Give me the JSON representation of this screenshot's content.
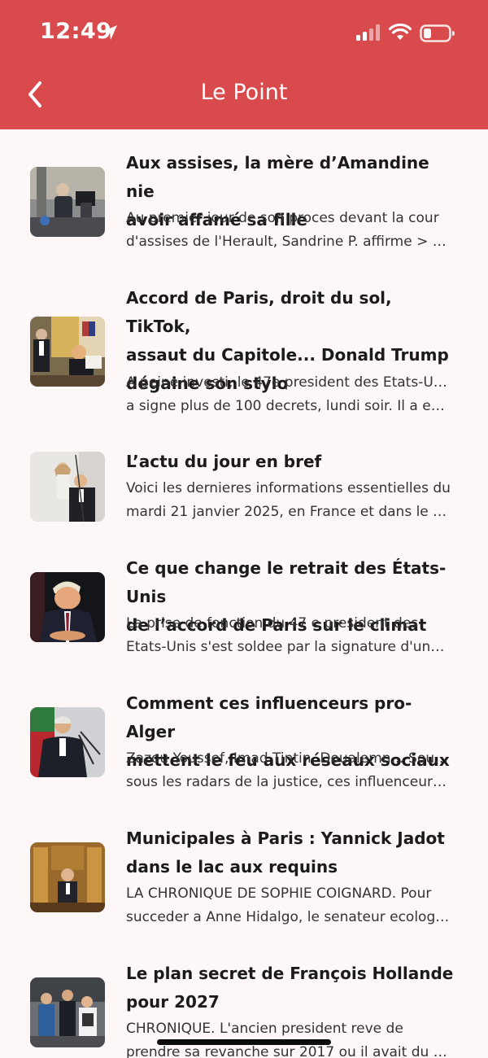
{
  "status_bar": {
    "time": "12:49",
    "icons": [
      "location-arrow-icon",
      "cellular-signal-icon",
      "wifi-icon",
      "battery-icon"
    ]
  },
  "nav": {
    "title": "Le Point",
    "back_icon": "chevron-left-icon"
  },
  "colors": {
    "header": "#d94a4c",
    "background": "#fdf7f7"
  },
  "articles": [
    {
      "title_lines": [
        "Aux assises, la mère d’Amandine nie",
        "avoir affamé sa fille"
      ],
      "desc_lines": [
        "Au premier jour de son proces devant la cour",
        "d'assises de l'Herault, Sandrine P. affirme > po..."
      ]
    },
    {
      "title_lines": [
        "Accord de Paris, droit du sol, TikTok,",
        "assaut du Capitole... Donald Trump",
        "dégaine son stylo"
      ],
      "desc_lines": [
        "A peine investi, le 47e president des Etats-Unis",
        "a signe plus de 100 decrets, lundi soir. Il a ega..."
      ]
    },
    {
      "title_lines": [
        "L’actu du jour en bref"
      ],
      "desc_lines": [
        "Voici les dernieres informations essentielles du",
        "mardi 21 janvier 2025, en France et dans le m..."
      ]
    },
    {
      "title_lines": [
        "Ce que change le retrait des États-Unis",
        "de l’accord de Paris sur le climat"
      ],
      "desc_lines": [
        "La prise de fonction du 47 e president des",
        "Etats-Unis s'est soldee par la signature d'une ..."
      ]
    },
    {
      "title_lines": [
        "Comment ces influenceurs pro-Alger",
        "mettent le feu aux réseaux sociaux"
      ],
      "desc_lines": [
        "Zazou Youssef, Imad Tintin, Doualemn... Souvent",
        "sous les radars de la justice, ces influenceurs ..."
      ]
    },
    {
      "title_lines": [
        "Municipales à Paris : Yannick Jadot",
        "dans le lac aux requins"
      ],
      "desc_lines": [
        "LA CHRONIQUE DE SOPHIE COIGNARD. Pour",
        "succeder a Anne Hidalgo, le senateur ecologis..."
      ]
    },
    {
      "title_lines": [
        "Le plan secret de François Hollande",
        "pour 2027"
      ],
      "desc_lines": [
        "CHRONIQUE. L'ancien president reve de",
        "prendre sa revanche sur 2017 ou il avait du s'..."
      ]
    }
  ]
}
